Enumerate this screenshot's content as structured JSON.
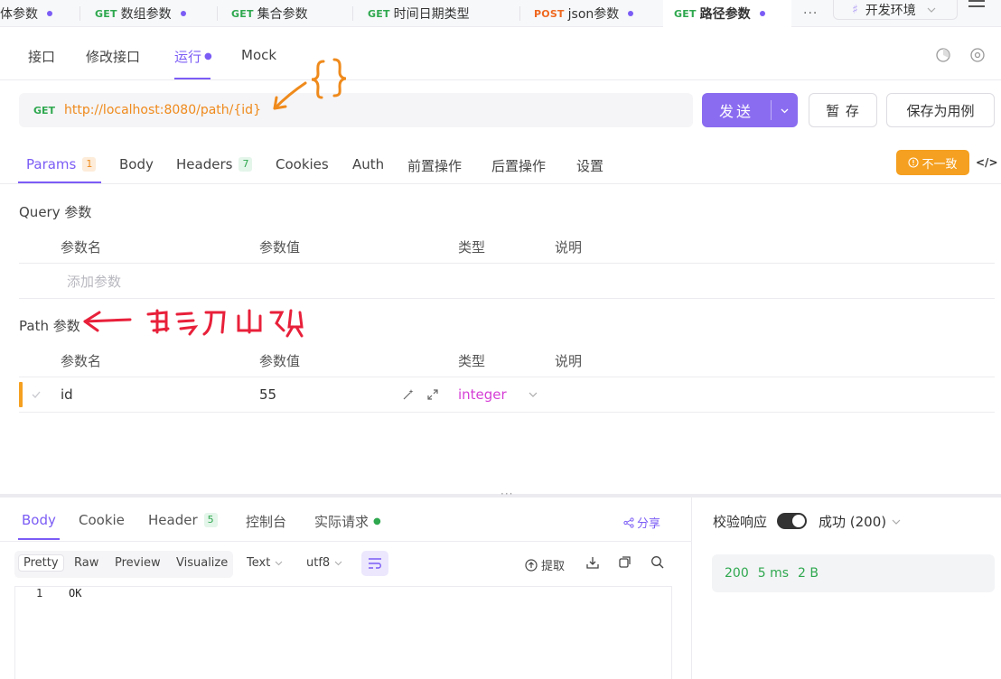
{
  "tabs": [
    {
      "method": "",
      "label": "体参数"
    },
    {
      "method": "GET",
      "label": "数组参数"
    },
    {
      "method": "GET",
      "label": "集合参数"
    },
    {
      "method": "GET",
      "label": "时间日期类型"
    },
    {
      "method": "POST",
      "label": "json参数"
    },
    {
      "method": "GET",
      "label": "路径参数"
    }
  ],
  "more_label": "···",
  "env": {
    "icon_text": "♯",
    "label": "开发环境"
  },
  "subtabs": [
    "接口",
    "修改接口",
    "运行",
    "Mock"
  ],
  "request": {
    "method": "GET",
    "url": "http://localhost:8080/path/{id}",
    "send_label": "发送",
    "save_temp_label": "暂 存",
    "save_case_label": "保存为用例"
  },
  "req_tabs": {
    "params": {
      "label": "Params",
      "badge": "1"
    },
    "body": "Body",
    "headers": {
      "label": "Headers",
      "badge": "7"
    },
    "cookies": "Cookies",
    "auth": "Auth",
    "pre": "前置操作",
    "post": "后置操作",
    "settings": "设置"
  },
  "inconsistent_label": "不一致",
  "code_toggle": "</>",
  "query": {
    "title": "Query 参数",
    "columns": [
      "参数名",
      "参数值",
      "类型",
      "说明"
    ],
    "placeholder": "添加参数"
  },
  "path": {
    "title": "Path 参数",
    "columns": [
      "参数名",
      "参数值",
      "类型",
      "说明"
    ],
    "rows": [
      {
        "name": "id",
        "value": "55",
        "type": "integer"
      }
    ]
  },
  "drag_handle": "···",
  "response": {
    "tabs": {
      "body": "Body",
      "cookie": "Cookie",
      "header": {
        "label": "Header",
        "badge": "5"
      },
      "console": "控制台",
      "actual": "实际请求"
    },
    "share_label": "分享",
    "format_tabs": [
      "Pretty",
      "Raw",
      "Preview",
      "Visualize"
    ],
    "text_select": "Text",
    "encoding_select": "utf8",
    "extract_label": "提取",
    "line_number": "1",
    "code": "OK",
    "validate_label": "校验响应",
    "status_select": "成功 (200)",
    "status_code": "200",
    "time": "5 ms",
    "size": "2 B"
  },
  "colors": {
    "accent": "#7b5cf5",
    "get": "#2fa84f",
    "post": "#ef6820",
    "url": "#ef8a1c",
    "warning": "#f5a020",
    "type": "#d63fd6",
    "annotation_orange": "#ef8a1c",
    "annotation_red": "#e8203a"
  }
}
